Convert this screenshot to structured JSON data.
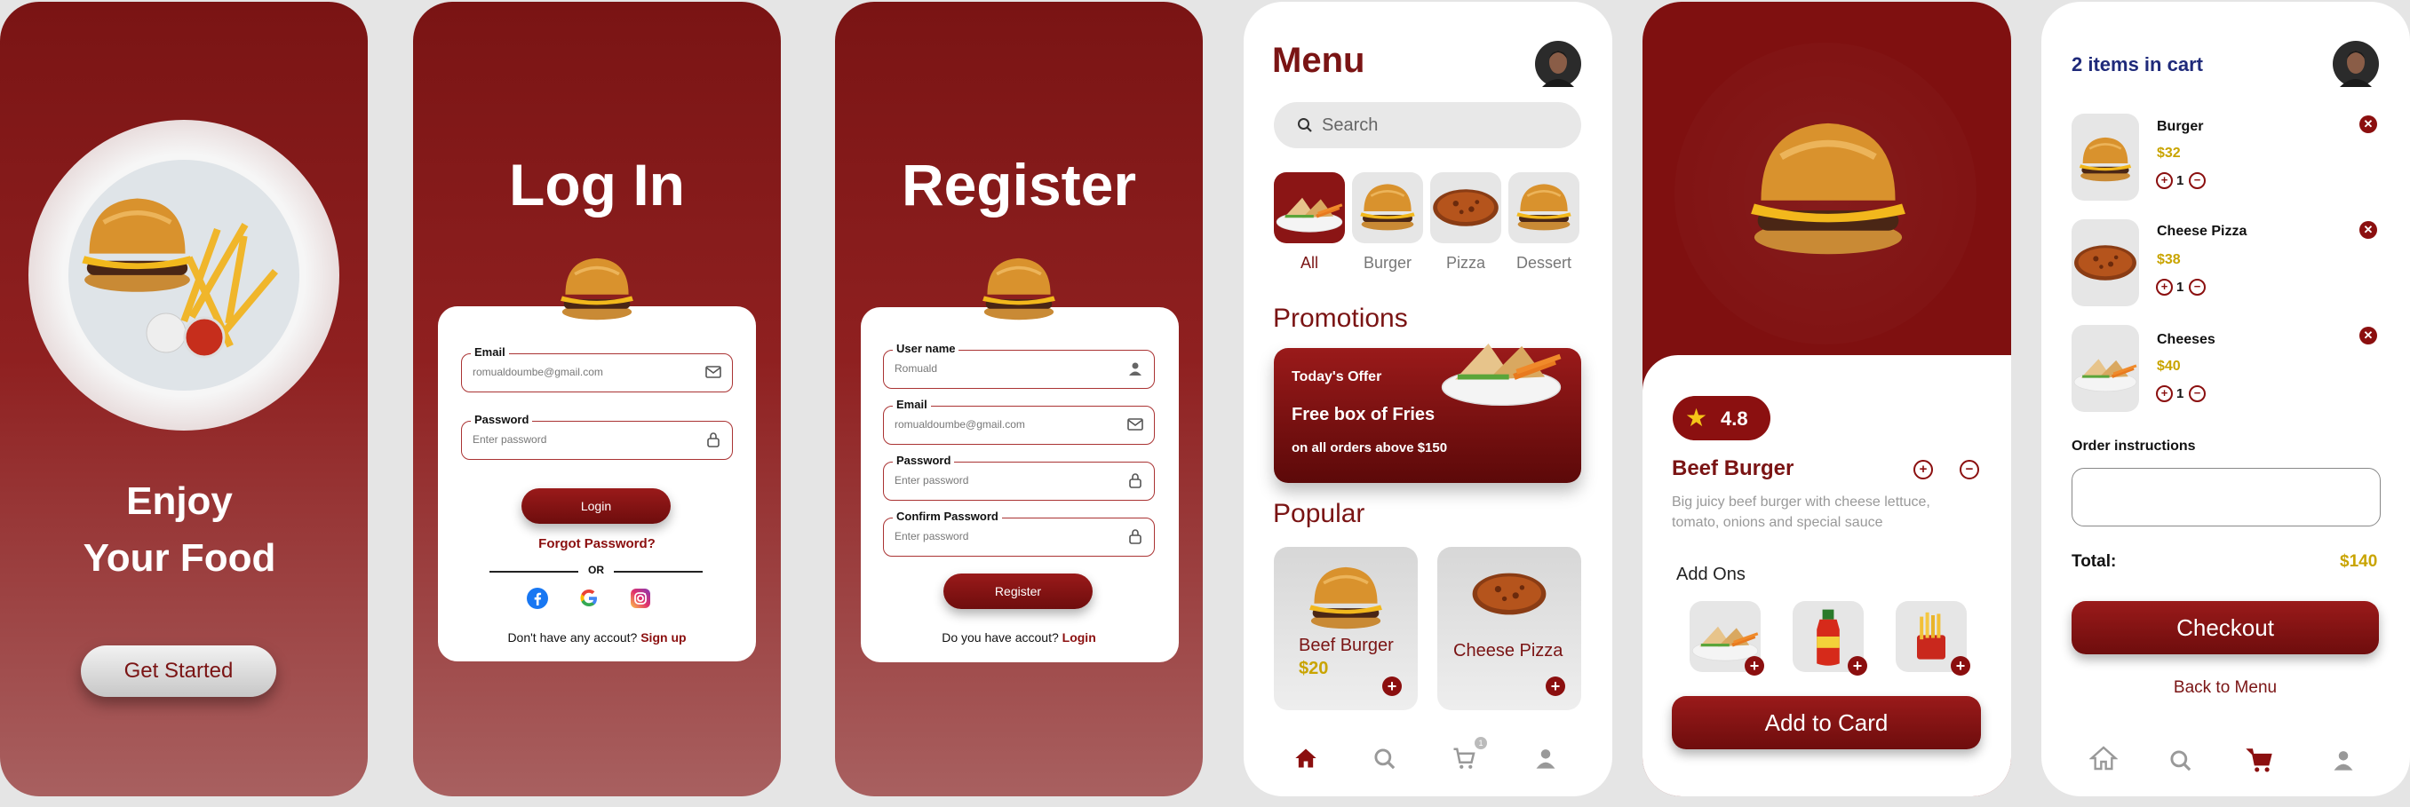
{
  "colors": {
    "brand": "#7a1414",
    "price": "#c9a400",
    "accent": "#8b0f0f"
  },
  "s1": {
    "line1": "Enjoy",
    "line2": "Your Food",
    "button": "Get Started"
  },
  "login": {
    "title": "Log In",
    "email_label": "Email",
    "email_value": "romualdoumbe@gmail.com",
    "password_label": "Password",
    "password_placeholder": "Enter password",
    "login_button": "Login",
    "forgot": "Forgot Password?",
    "or": "OR",
    "no_account": "Don't have any accout?",
    "signup": "Sign up"
  },
  "register": {
    "title": "Register",
    "user_label": "User name",
    "user_value": "Romuald",
    "email_label": "Email",
    "email_value": "romualdoumbe@gmail.com",
    "password_label": "Password",
    "password_placeholder": "Enter password",
    "confirm_label": "Confirm Password",
    "confirm_placeholder": "Enter password",
    "button": "Register",
    "have_account": "Do you have  accout?",
    "login_link": "Login"
  },
  "menu": {
    "title": "Menu",
    "search_placeholder": "Search",
    "categories": [
      {
        "label": "All"
      },
      {
        "label": "Burger"
      },
      {
        "label": "Pizza"
      },
      {
        "label": "Dessert"
      }
    ],
    "promotions_title": "Promotions",
    "promo_kicker": "Today's Offer",
    "promo_headline": "Free box of Fries",
    "promo_sub": "on all orders above $150",
    "popular_title": "Popular",
    "popular": [
      {
        "name": "Beef Burger",
        "price": "$20"
      },
      {
        "name": "Cheese Pizza",
        "price": ""
      }
    ],
    "cart_badge": "1"
  },
  "detail": {
    "rating": "4.8",
    "name": "Beef Burger",
    "description": "Big juicy beef burger with cheese lettuce, tomato, onions and special sauce",
    "addons_title": "Add Ons",
    "button": "Add  to Card"
  },
  "cart": {
    "title": "2 items in cart",
    "items": [
      {
        "name": "Burger",
        "price": "$32",
        "qty": "1"
      },
      {
        "name": "Cheese Pizza",
        "price": "$38",
        "qty": "1"
      },
      {
        "name": "Cheeses",
        "price": "$40",
        "qty": "1"
      }
    ],
    "instructions_label": "Order instructions",
    "total_label": "Total:",
    "total_value": "$140",
    "checkout": "Checkout",
    "back": "Back to Menu"
  }
}
